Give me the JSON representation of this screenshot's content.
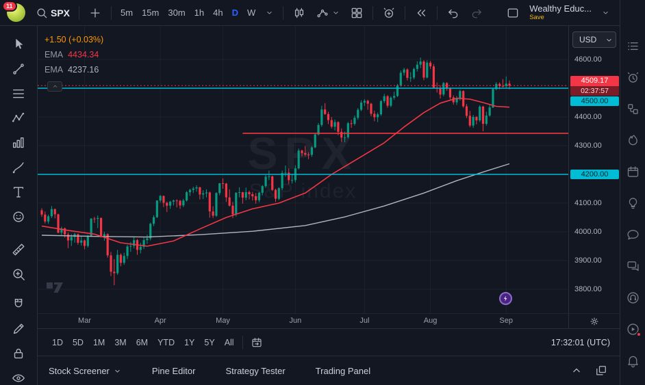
{
  "colors": {
    "accent_blue": "#2962ff",
    "up_green": "#089981",
    "down_red": "#f23645",
    "cyan": "#00bcd4",
    "change_orange": "#ff9800",
    "save_yellow": "#f0b90b"
  },
  "top_toolbar": {
    "notification_count": "11",
    "symbol": "SPX",
    "timeframes": [
      "5m",
      "15m",
      "30m",
      "1h",
      "4h",
      "D",
      "W"
    ],
    "active_timeframe": "D",
    "layout_name": "Wealthy Educ...",
    "save_label": "Save"
  },
  "left_toolbar": {
    "tools": [
      "cursor-icon",
      "trend-line-icon",
      "fib-retracement-icon",
      "xabcd-pattern-icon",
      "forecast-icon",
      "brush-icon",
      "text-icon",
      "emoji-icon",
      "ruler-icon",
      "zoom-in-icon",
      "magnet-icon",
      "pencil-icon",
      "lock-icon",
      "eye-icon"
    ]
  },
  "right_rail": {
    "items": [
      "watchlist-icon",
      "alerts-icon",
      "object-tree-icon",
      "hotlists-icon",
      "calendar-icon",
      "ideas-icon",
      "chat-icon",
      "conversations-icon",
      "support-icon",
      "streams-icon",
      "notifications-icon"
    ],
    "red_dot_on": "streams-icon"
  },
  "legend": {
    "change_text": "+1.50 (+0.03%)",
    "rows": [
      {
        "label": "EMA",
        "value": "4434.34"
      },
      {
        "label": "EMA",
        "value": "4237.16"
      }
    ]
  },
  "price_axis": {
    "currency": "USD",
    "plain_labels": [
      "4600.00",
      "4400.00",
      "4300.00",
      "4100.00",
      "4000.00",
      "3900.00",
      "3800.00"
    ],
    "plain_prices": [
      4600,
      4400,
      4300,
      4100,
      4000,
      3900,
      3800
    ],
    "last_price_label": "4509.17",
    "countdown": "02:37:57",
    "level_labels": [
      {
        "text": "4500.00",
        "price": 4500
      },
      {
        "text": "4200.00",
        "price": 4200
      }
    ]
  },
  "time_axis": {
    "months": [
      "Mar",
      "Apr",
      "May",
      "Jun",
      "Jul",
      "Aug",
      "Sep"
    ]
  },
  "interval_bar": {
    "ranges": [
      "1D",
      "5D",
      "1M",
      "3M",
      "6M",
      "YTD",
      "1Y",
      "5Y",
      "All"
    ],
    "clock": "17:32:01 (UTC)"
  },
  "status_bar": {
    "tabs": [
      "Stock Screener",
      "Pine Editor",
      "Strategy Tester",
      "Trading Panel"
    ]
  },
  "watermark": {
    "symbol": "SPX",
    "description": "S&P index"
  },
  "chart_data": {
    "type": "candlestick",
    "symbol": "SPX",
    "interval": "D",
    "last_price": 4509.17,
    "change": "+1.50",
    "change_percent": "+0.03%",
    "y_ticks": [
      3800,
      3900,
      4000,
      4100,
      4200,
      4300,
      4400,
      4500,
      4600
    ],
    "ylim": [
      3780,
      4650
    ],
    "month_ticks": [
      {
        "label": "Mar",
        "index": 13
      },
      {
        "label": "Apr",
        "index": 36
      },
      {
        "label": "May",
        "index": 55
      },
      {
        "label": "Jun",
        "index": 77
      },
      {
        "label": "Jul",
        "index": 98
      },
      {
        "label": "Aug",
        "index": 118
      },
      {
        "label": "Sep",
        "index": 141
      }
    ],
    "candles": [
      [
        4075,
        4082,
        4052,
        4060
      ],
      [
        4060,
        4071,
        4029,
        4036
      ],
      [
        4036,
        4060,
        4028,
        4054
      ],
      [
        4054,
        4090,
        4048,
        4079
      ],
      [
        4079,
        4081,
        4047,
        4061
      ],
      [
        4061,
        4063,
        3995,
        3997
      ],
      [
        3997,
        4018,
        3989,
        4012
      ],
      [
        4012,
        4015,
        3980,
        3991
      ],
      [
        3991,
        3998,
        3943,
        3970
      ],
      [
        3970,
        3992,
        3951,
        3982
      ],
      [
        3982,
        3997,
        3962,
        3992
      ],
      [
        3992,
        3994,
        3955,
        3962
      ],
      [
        3962,
        3985,
        3952,
        3970
      ],
      [
        3970,
        3973,
        3939,
        3951
      ],
      [
        3951,
        3990,
        3945,
        3986
      ],
      [
        3986,
        4048,
        3982,
        4046
      ],
      [
        4046,
        4052,
        4031,
        4045
      ],
      [
        4045,
        4057,
        4013,
        4048
      ],
      [
        4048,
        4050,
        3980,
        3986
      ],
      [
        3986,
        4000,
        3969,
        3992
      ],
      [
        3992,
        3995,
        3910,
        3918
      ],
      [
        3918,
        3930,
        3846,
        3861
      ],
      [
        3861,
        3905,
        3814,
        3856
      ],
      [
        3856,
        3937,
        3850,
        3920
      ],
      [
        3920,
        3925,
        3880,
        3892
      ],
      [
        3892,
        3927,
        3885,
        3916
      ],
      [
        3916,
        3955,
        3905,
        3949
      ],
      [
        3949,
        3965,
        3930,
        3951
      ],
      [
        3951,
        3983,
        3942,
        3971
      ],
      [
        3971,
        3975,
        3920,
        3937
      ],
      [
        3937,
        3962,
        3925,
        3948
      ],
      [
        3948,
        3980,
        3940,
        3971
      ],
      [
        3971,
        3990,
        3958,
        3977
      ],
      [
        3977,
        4032,
        3970,
        4028
      ],
      [
        4028,
        4058,
        4020,
        4051
      ],
      [
        4051,
        4110,
        4048,
        4109
      ],
      [
        4109,
        4128,
        4102,
        4125
      ],
      [
        4125,
        4126,
        4086,
        4101
      ],
      [
        4101,
        4105,
        4069,
        4091
      ],
      [
        4091,
        4108,
        4080,
        4105
      ],
      [
        4105,
        4112,
        4092,
        4109
      ],
      [
        4109,
        4113,
        4085,
        4108
      ],
      [
        4108,
        4111,
        4080,
        4092
      ],
      [
        4092,
        4115,
        4086,
        4109
      ],
      [
        4109,
        4142,
        4105,
        4138
      ],
      [
        4138,
        4150,
        4125,
        4146
      ],
      [
        4146,
        4157,
        4135,
        4151
      ],
      [
        4151,
        4162,
        4140,
        4155
      ],
      [
        4155,
        4157,
        4113,
        4130
      ],
      [
        4130,
        4145,
        4114,
        4134
      ],
      [
        4134,
        4148,
        4120,
        4137
      ],
      [
        4137,
        4140,
        4049,
        4071
      ],
      [
        4071,
        4089,
        4048,
        4056
      ],
      [
        4056,
        4138,
        4052,
        4135
      ],
      [
        4135,
        4170,
        4127,
        4169
      ],
      [
        4169,
        4186,
        4150,
        4168
      ],
      [
        4168,
        4170,
        4104,
        4120
      ],
      [
        4120,
        4148,
        4088,
        4091
      ],
      [
        4091,
        4104,
        4048,
        4061
      ],
      [
        4061,
        4138,
        4053,
        4136
      ],
      [
        4136,
        4155,
        4120,
        4138
      ],
      [
        4138,
        4139,
        4098,
        4119
      ],
      [
        4119,
        4154,
        4110,
        4138
      ],
      [
        4138,
        4143,
        4113,
        4131
      ],
      [
        4131,
        4139,
        4109,
        4124
      ],
      [
        4124,
        4135,
        4098,
        4110
      ],
      [
        4110,
        4139,
        4103,
        4136
      ],
      [
        4136,
        4163,
        4127,
        4159
      ],
      [
        4159,
        4198,
        4153,
        4192
      ],
      [
        4192,
        4213,
        4180,
        4193
      ],
      [
        4193,
        4196,
        4142,
        4146
      ],
      [
        4146,
        4150,
        4104,
        4115
      ],
      [
        4115,
        4155,
        4110,
        4152
      ],
      [
        4152,
        4213,
        4146,
        4205
      ],
      [
        4205,
        4231,
        4192,
        4206
      ],
      [
        4206,
        4220,
        4166,
        4180
      ],
      [
        4180,
        4202,
        4168,
        4180
      ],
      [
        4180,
        4232,
        4172,
        4221
      ],
      [
        4221,
        4290,
        4217,
        4283
      ],
      [
        4283,
        4286,
        4263,
        4274
      ],
      [
        4274,
        4299,
        4263,
        4269
      ],
      [
        4269,
        4277,
        4253,
        4268
      ],
      [
        4268,
        4298,
        4261,
        4294
      ],
      [
        4294,
        4344,
        4291,
        4339
      ],
      [
        4339,
        4379,
        4335,
        4372
      ],
      [
        4372,
        4439,
        4366,
        4426
      ],
      [
        4426,
        4448,
        4407,
        4410
      ],
      [
        4410,
        4418,
        4375,
        4389
      ],
      [
        4389,
        4400,
        4360,
        4366
      ],
      [
        4366,
        4391,
        4353,
        4382
      ],
      [
        4382,
        4385,
        4336,
        4348
      ],
      [
        4348,
        4360,
        4313,
        4328
      ],
      [
        4328,
        4349,
        4312,
        4329
      ],
      [
        4329,
        4383,
        4325,
        4378
      ],
      [
        4378,
        4390,
        4362,
        4376
      ],
      [
        4376,
        4405,
        4370,
        4397
      ],
      [
        4397,
        4431,
        4390,
        4425
      ],
      [
        4425,
        4458,
        4420,
        4450
      ],
      [
        4450,
        4462,
        4438,
        4456
      ],
      [
        4456,
        4460,
        4425,
        4446
      ],
      [
        4446,
        4449,
        4403,
        4411
      ],
      [
        4411,
        4422,
        4385,
        4399
      ],
      [
        4399,
        4415,
        4382,
        4409
      ],
      [
        4409,
        4459,
        4404,
        4455
      ],
      [
        4455,
        4480,
        4448,
        4472
      ],
      [
        4472,
        4476,
        4432,
        4439
      ],
      [
        4439,
        4472,
        4434,
        4467
      ],
      [
        4467,
        4488,
        4460,
        4473
      ],
      [
        4473,
        4515,
        4469,
        4510
      ],
      [
        4510,
        4562,
        4505,
        4554
      ],
      [
        4554,
        4571,
        4544,
        4565
      ],
      [
        4565,
        4569,
        4527,
        4536
      ],
      [
        4536,
        4556,
        4522,
        4537
      ],
      [
        4537,
        4572,
        4531,
        4567
      ],
      [
        4567,
        4594,
        4558,
        4582
      ],
      [
        4582,
        4607,
        4570,
        4593
      ],
      [
        4593,
        4598,
        4528,
        4537
      ],
      [
        4537,
        4597,
        4534,
        4589
      ],
      [
        4589,
        4595,
        4567,
        4576
      ],
      [
        4576,
        4584,
        4500,
        4502
      ],
      [
        4502,
        4520,
        4485,
        4501
      ],
      [
        4501,
        4510,
        4464,
        4478
      ],
      [
        4478,
        4522,
        4472,
        4518
      ],
      [
        4518,
        4521,
        4491,
        4499
      ],
      [
        4499,
        4503,
        4461,
        4468
      ],
      [
        4468,
        4475,
        4443,
        4451
      ],
      [
        4451,
        4473,
        4442,
        4464
      ],
      [
        4464,
        4495,
        4457,
        4490
      ],
      [
        4490,
        4493,
        4432,
        4437
      ],
      [
        4437,
        4445,
        4396,
        4404
      ],
      [
        4404,
        4421,
        4364,
        4370
      ],
      [
        4370,
        4407,
        4362,
        4400
      ],
      [
        4400,
        4403,
        4374,
        4388
      ],
      [
        4388,
        4441,
        4382,
        4436
      ],
      [
        4436,
        4439,
        4350,
        4376
      ],
      [
        4376,
        4418,
        4370,
        4405
      ],
      [
        4405,
        4445,
        4401,
        4433
      ],
      [
        4433,
        4501,
        4431,
        4497
      ],
      [
        4497,
        4521,
        4493,
        4515
      ],
      [
        4515,
        4520,
        4496,
        4508
      ],
      [
        4508,
        4532,
        4503,
        4507
      ],
      [
        4507,
        4541,
        4501,
        4516
      ],
      [
        4516,
        4527,
        4496,
        4509
      ]
    ],
    "ema_fast": {
      "label": "EMA",
      "last_value": 4434.34,
      "color": "#f23645",
      "points": [
        [
          0,
          4020
        ],
        [
          8,
          4005
        ],
        [
          16,
          3992
        ],
        [
          24,
          3962
        ],
        [
          32,
          3950
        ],
        [
          40,
          3968
        ],
        [
          48,
          4010
        ],
        [
          56,
          4050
        ],
        [
          64,
          4080
        ],
        [
          72,
          4100
        ],
        [
          80,
          4135
        ],
        [
          88,
          4200
        ],
        [
          96,
          4255
        ],
        [
          104,
          4310
        ],
        [
          110,
          4365
        ],
        [
          116,
          4415
        ],
        [
          121,
          4448
        ],
        [
          126,
          4465
        ],
        [
          130,
          4462
        ],
        [
          134,
          4450
        ],
        [
          138,
          4437
        ],
        [
          142,
          4434
        ]
      ]
    },
    "ema_slow": {
      "label": "EMA",
      "last_value": 4237.16,
      "color": "#b2b5be",
      "points": [
        [
          0,
          3988
        ],
        [
          16,
          3984
        ],
        [
          32,
          3982
        ],
        [
          48,
          3990
        ],
        [
          64,
          4002
        ],
        [
          80,
          4022
        ],
        [
          92,
          4052
        ],
        [
          104,
          4090
        ],
        [
          116,
          4135
        ],
        [
          126,
          4178
        ],
        [
          134,
          4208
        ],
        [
          142,
          4237
        ]
      ]
    },
    "horizontal_lines": [
      {
        "price": 4500,
        "color": "#00bcd4"
      },
      {
        "price": 4200,
        "color": "#00bcd4"
      },
      {
        "price": 4343,
        "color": "#f23645",
        "from_index": 61
      }
    ],
    "price_line": {
      "price": 4509.17,
      "style": "dashed",
      "color": "#f23645"
    }
  }
}
